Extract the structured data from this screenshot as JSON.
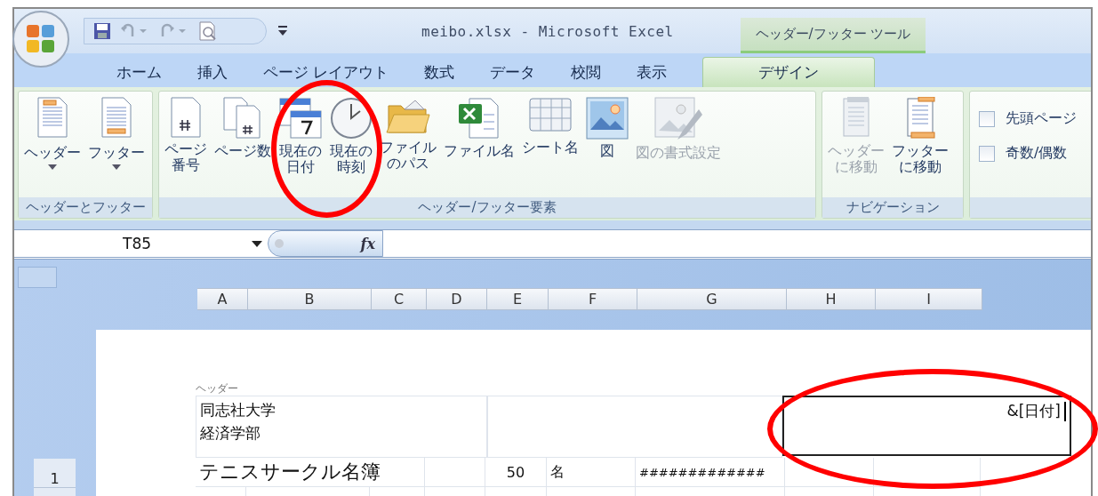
{
  "title_bar": {
    "title": "meibo.xlsx - Microsoft Excel",
    "contextual_tab": "ヘッダー/フッター ツール"
  },
  "tabs": [
    {
      "label": "ホーム",
      "selected": false
    },
    {
      "label": "挿入",
      "selected": false
    },
    {
      "label": "ページ レイアウト",
      "selected": false
    },
    {
      "label": "数式",
      "selected": false
    },
    {
      "label": "データ",
      "selected": false
    },
    {
      "label": "校閲",
      "selected": false
    },
    {
      "label": "表示",
      "selected": false
    },
    {
      "label": "デザイン",
      "selected": true
    }
  ],
  "ribbon_groups": [
    {
      "label": "ヘッダーとフッター",
      "buttons": [
        {
          "lines": [
            "ヘッダー"
          ],
          "dropdown": true,
          "disabled": false
        },
        {
          "lines": [
            "フッター"
          ],
          "dropdown": true,
          "disabled": false
        }
      ]
    },
    {
      "label": "ヘッダー/フッター要素",
      "buttons": [
        {
          "lines": [
            "ページ",
            "番号"
          ],
          "disabled": false
        },
        {
          "lines": [
            "ページ数"
          ],
          "disabled": false
        },
        {
          "lines": [
            "現在の",
            "日付"
          ],
          "disabled": false
        },
        {
          "lines": [
            "現在の",
            "時刻"
          ],
          "disabled": false
        },
        {
          "lines": [
            "ファイル",
            "のパス"
          ],
          "disabled": false
        },
        {
          "lines": [
            "ファイル名"
          ],
          "disabled": false
        },
        {
          "lines": [
            "シート名"
          ],
          "disabled": false
        },
        {
          "lines": [
            "図"
          ],
          "disabled": false
        },
        {
          "lines": [
            "図の書式設定"
          ],
          "disabled": true
        }
      ]
    },
    {
      "label": "ナビゲーション",
      "buttons": [
        {
          "lines": [
            "ヘッダー",
            "に移動"
          ],
          "disabled": true
        },
        {
          "lines": [
            "フッター",
            "に移動"
          ],
          "disabled": false
        }
      ]
    },
    {
      "checkboxes": [
        {
          "label": "先頭ページ",
          "checked": false
        },
        {
          "label": "奇数/偶数",
          "checked": false
        }
      ]
    }
  ],
  "formula_bar": {
    "name_box": "T85",
    "function_label": "fx"
  },
  "columns": [
    "A",
    "B",
    "C",
    "D",
    "E",
    "F",
    "G",
    "H",
    "I"
  ],
  "page_header": {
    "label": "ヘッダー",
    "sections": [
      {
        "lines": [
          "同志社大学",
          "経済学部"
        ],
        "selected": false
      },
      {
        "selected": false
      },
      {
        "lines": [
          "&[日付]"
        ],
        "selected": true
      }
    ]
  },
  "rows": [
    {
      "number": "1",
      "cells": [
        "テニスサークル名簿",
        "",
        "50",
        "名",
        "#############",
        "",
        ""
      ]
    }
  ],
  "annotations": [
    {
      "kind": "ellipse"
    },
    {
      "kind": "ellipse"
    }
  ]
}
